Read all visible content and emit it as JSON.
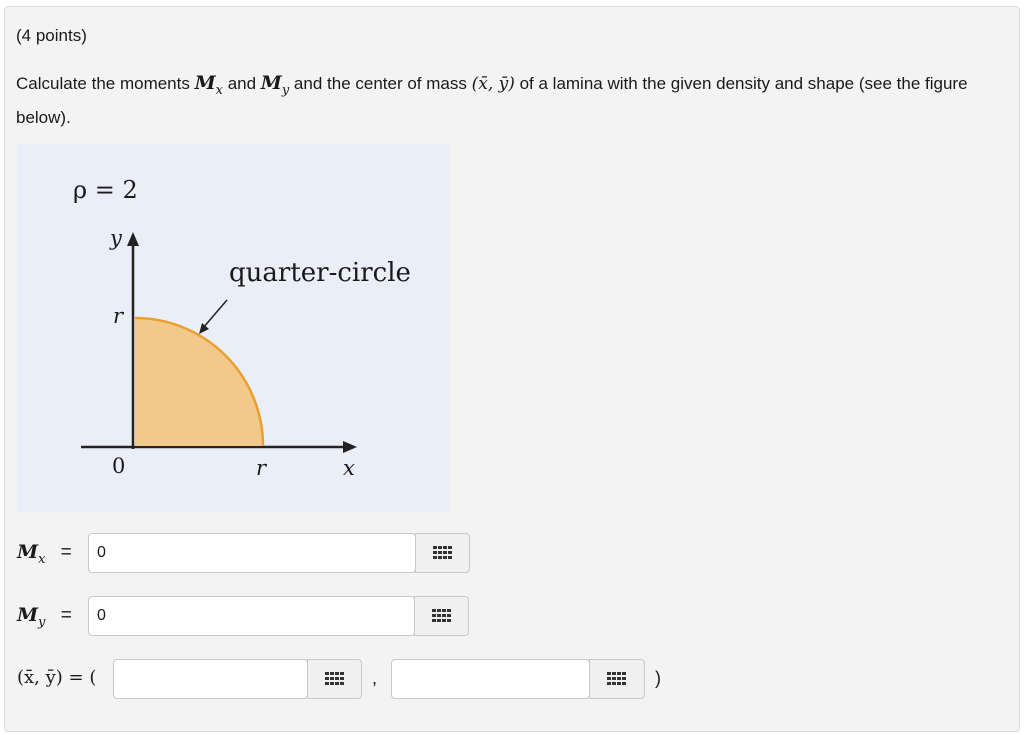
{
  "header": {
    "points": "(4 points)"
  },
  "question": {
    "part1": "Calculate the moments ",
    "mx_sym": "M",
    "mx_sub": "x",
    "part2": " and ",
    "my_sym": "M",
    "my_sub": "y",
    "part3": " and the center of mass ",
    "com_sym": "(x̄, ȳ)",
    "part4": " of a lamina with the given density and shape (see the figure below)."
  },
  "figure": {
    "density": "ρ = 2",
    "y_axis": "y",
    "x_axis": "x",
    "r_left": "r",
    "r_bottom": "r",
    "origin": "0",
    "annotation": "quarter-circle",
    "colors": {
      "fill": "#f2c98a",
      "edge": "#e8a030",
      "background": "#e9eef8"
    }
  },
  "answers": {
    "mx": {
      "label_sym": "M",
      "label_sub": "x",
      "eq": "=",
      "value": "0",
      "icon": "grid-icon"
    },
    "my": {
      "label_sym": "M",
      "label_sub": "y",
      "eq": "=",
      "value": "0",
      "icon": "grid-icon"
    },
    "com": {
      "label": "(x̄, ȳ) = (",
      "x_value": "",
      "comma": ",",
      "y_value": "",
      "close": ")",
      "icon": "grid-icon"
    }
  }
}
